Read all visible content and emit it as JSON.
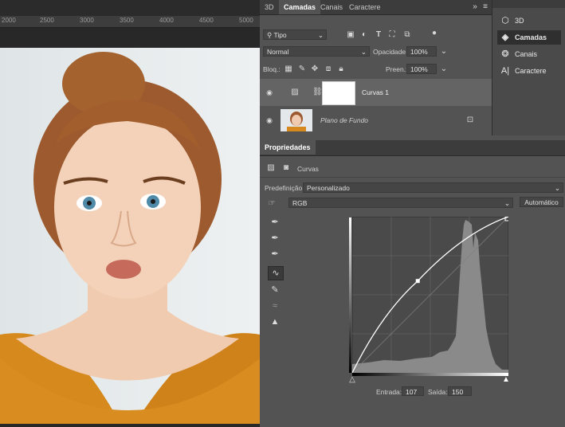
{
  "canvas": {
    "ruler_ticks": [
      "2000",
      "2500",
      "3000",
      "3500",
      "4000",
      "4500",
      "5000"
    ]
  },
  "layers_panel": {
    "tabs": [
      {
        "label": "3D",
        "active": false
      },
      {
        "label": "Camadas",
        "active": true
      },
      {
        "label": "Canais",
        "active": false
      },
      {
        "label": "Caractere",
        "active": false
      }
    ],
    "filter_kind": "Tipo",
    "blend_mode": "Normal",
    "opacity_label": "Opacidade:",
    "opacity_value": "100%",
    "lock_label": "Bloq.:",
    "fill_label": "Preen.:",
    "fill_value": "100%",
    "layers": [
      {
        "name": "Curvas 1",
        "italic": false,
        "selected": true
      },
      {
        "name": "Plano de Fundo",
        "italic": true,
        "selected": false,
        "locked": true
      }
    ]
  },
  "side_panel": {
    "items": [
      {
        "label": "3D",
        "icon": "cube-icon",
        "active": false
      },
      {
        "label": "Camadas",
        "icon": "layers-icon",
        "active": true
      },
      {
        "label": "Canais",
        "icon": "channels-icon",
        "active": false
      },
      {
        "label": "Caractere",
        "icon": "character-icon",
        "active": false
      }
    ]
  },
  "properties": {
    "title": "Propriedades",
    "adjustment": "Curvas",
    "preset_label": "Predefinição:",
    "preset_value": "Personalizado",
    "channel": "RGB",
    "auto_button": "Automático",
    "input_label": "Entrada:",
    "input_value": "107",
    "output_label": "Saída:",
    "output_value": "150",
    "curve_point": {
      "input": 107,
      "output": 150
    },
    "colors": {
      "accent_selected": "#646464",
      "curve": "#ffffff",
      "histogram": "#8a8a8a"
    }
  }
}
